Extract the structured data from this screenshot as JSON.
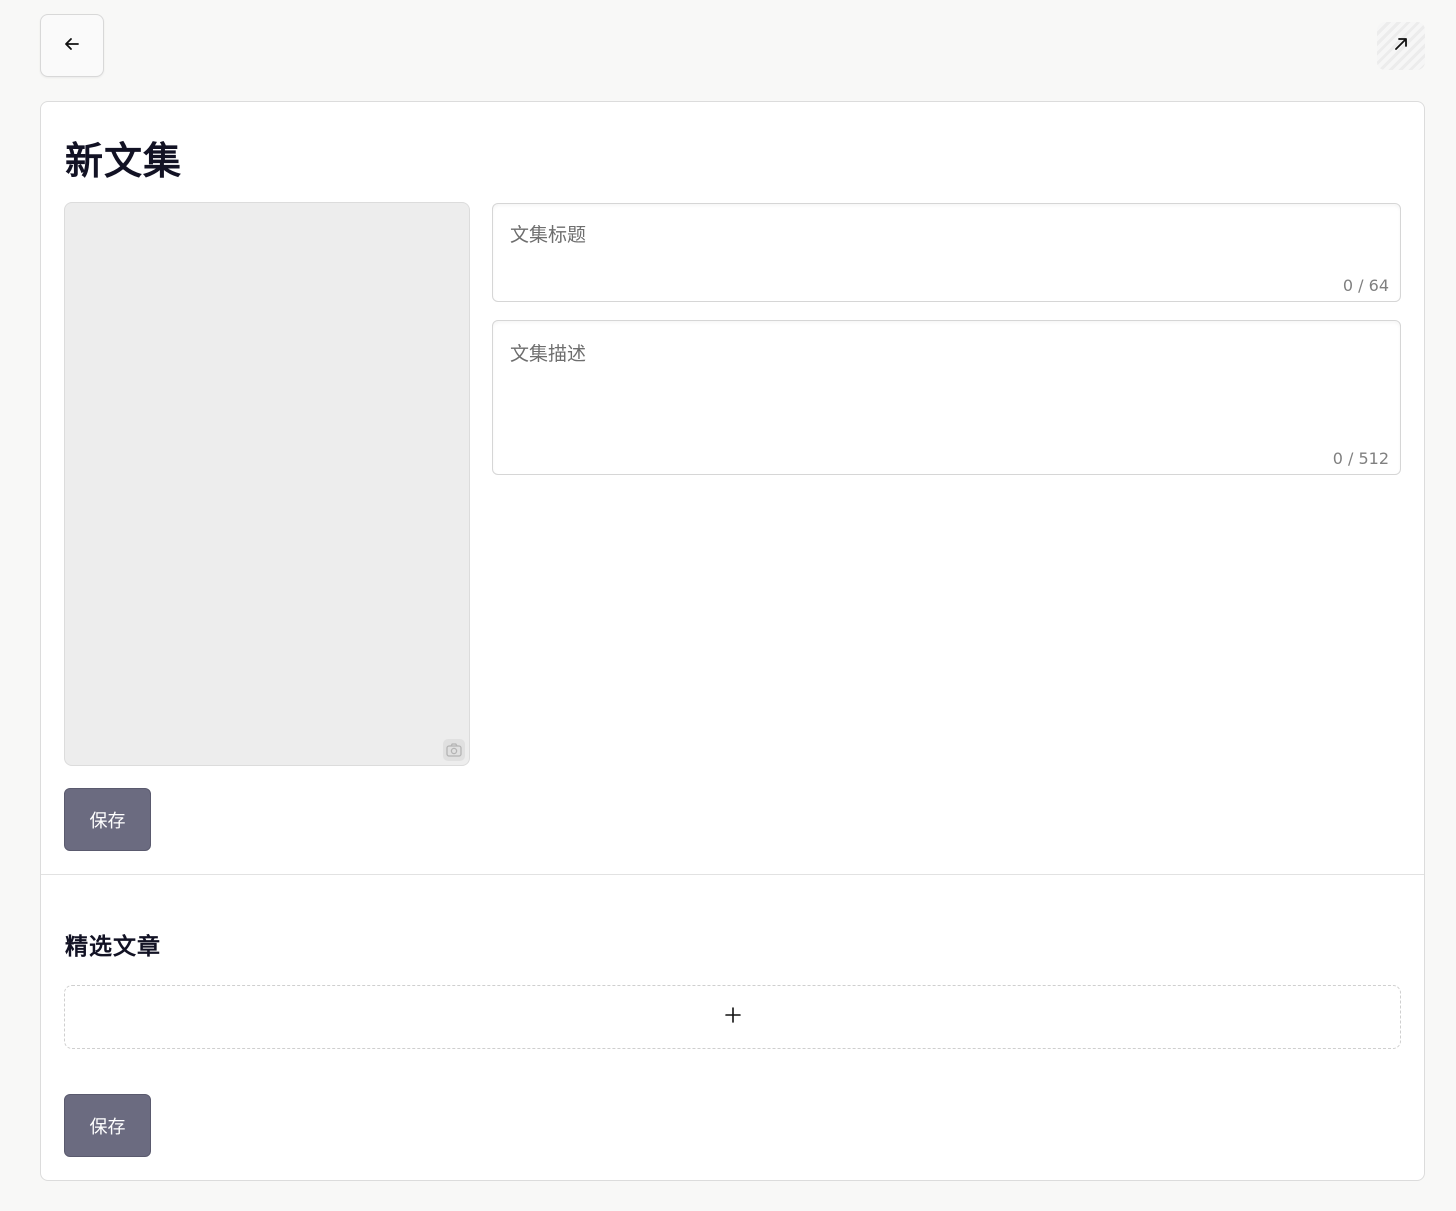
{
  "header": {
    "back_icon": "arrow-left-icon",
    "expand_icon": "arrow-up-right-icon"
  },
  "page": {
    "title": "新文集"
  },
  "form": {
    "cover_icon": "camera-icon",
    "title_placeholder": "文集标题",
    "title_value": "",
    "title_counter": "0 / 64",
    "description_placeholder": "文集描述",
    "description_value": "",
    "description_counter": "0 / 512",
    "save_label": "保存"
  },
  "featured": {
    "title": "精选文章",
    "add_icon": "plus-icon",
    "add_symbol": "+",
    "save_label": "保存"
  }
}
